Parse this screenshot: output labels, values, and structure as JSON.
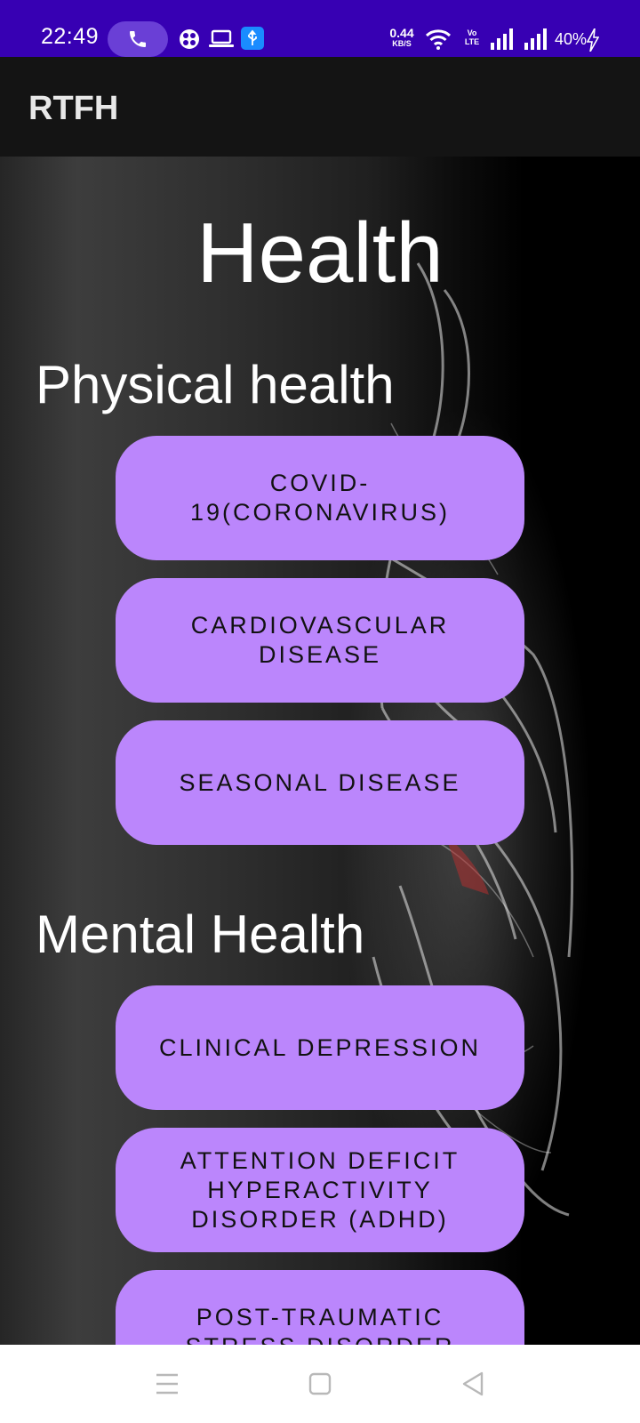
{
  "status_bar": {
    "time": "22:49",
    "net_speed_value": "0.44",
    "net_speed_unit": "KB/S",
    "volte_label": "Vo\nLTE",
    "battery_percent": "40%",
    "icons": [
      "phone-call-icon",
      "multi-app-icon",
      "laptop-icon",
      "usb-icon",
      "wifi-icon",
      "signal-icon",
      "signal-icon",
      "charging-icon"
    ]
  },
  "app_bar": {
    "title": "RTFH"
  },
  "main": {
    "title": "Health",
    "physical": {
      "heading": "Physical health",
      "buttons": [
        "COVID-19(CORONAVIRUS)",
        "CARDIOVASCULAR DISEASE",
        "SEASONAL DISEASE"
      ]
    },
    "mental": {
      "heading": "Mental Health",
      "buttons": [
        "CLINICAL DEPRESSION",
        "ATTENTION DEFICIT HYPERACTIVITY DISORDER (ADHD)",
        "POST-TRAUMATIC STRESS DISORDER"
      ]
    }
  },
  "nav_bar": {
    "icons": [
      "menu-icon",
      "home-icon",
      "back-icon"
    ]
  },
  "colors": {
    "status_bar": "#3700b3",
    "app_bar": "#141414",
    "button": "#bb86fc",
    "button_text": "#111111"
  }
}
